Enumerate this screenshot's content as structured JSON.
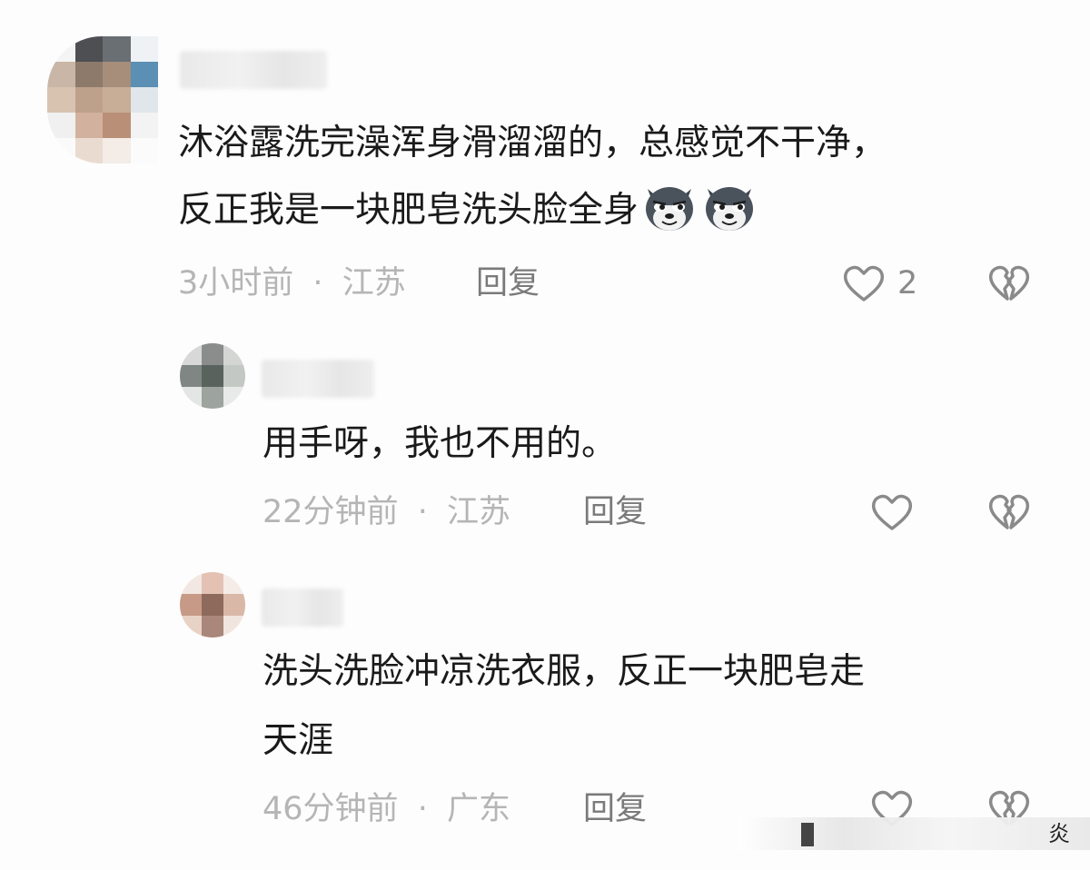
{
  "comments": [
    {
      "text_lines": [
        "沐浴露洗完澡浑身滑溜溜的，总感觉不干净，",
        "反正我是一块肥皂洗头脸全身"
      ],
      "emojis": [
        "wolf-grin-emoji",
        "wolf-grin-emoji"
      ],
      "time": "3小时前",
      "separator": "·",
      "location": "江苏",
      "reply_label": "回复",
      "like_count": "2"
    },
    {
      "text_lines": [
        "用手呀，我也不用的。"
      ],
      "time": "22分钟前",
      "separator": "·",
      "location": "江苏",
      "reply_label": "回复"
    },
    {
      "text_lines": [
        "洗头洗脸冲凉洗衣服，反正一块肥皂走",
        "天涯"
      ],
      "time": "46分钟前",
      "separator": "·",
      "location": "广东",
      "reply_label": "回复"
    }
  ],
  "watermark": {
    "text": "炎"
  },
  "colors": {
    "background": "#fdfdfd",
    "text": "#1a1a1a",
    "meta": "#b5b5b5",
    "reply": "#7a7a7a",
    "icon_stroke": "#8a8a8a"
  }
}
